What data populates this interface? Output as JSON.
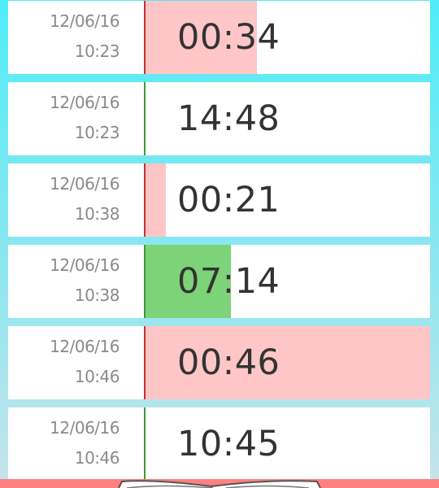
{
  "entries": [
    {
      "date": "12/06/16",
      "time": "10:23",
      "duration": "00:34",
      "status": "over",
      "fill": 0.39
    },
    {
      "date": "12/06/16",
      "time": "10:23",
      "duration": "14:48",
      "status": "ok",
      "fill": 0
    },
    {
      "date": "12/06/16",
      "time": "10:38",
      "duration": "00:21",
      "status": "over",
      "fill": 0.07
    },
    {
      "date": "12/06/16",
      "time": "10:38",
      "duration": "07:14",
      "status": "ok",
      "fill": 0.3
    },
    {
      "date": "12/06/16",
      "time": "10:46",
      "duration": "00:46",
      "status": "over",
      "fill": 1.0
    },
    {
      "date": "12/06/16",
      "time": "10:46",
      "duration": "10:45",
      "status": "ok",
      "fill": 0
    }
  ],
  "colors": {
    "over_bar": "#ffc6c8",
    "ok_bar": "#7dd378",
    "over_divider": "#c9302c",
    "ok_divider": "#3c9a3a",
    "bottom_bar": "#ff8080"
  },
  "bottom": {
    "icon": "open-book-icon"
  }
}
